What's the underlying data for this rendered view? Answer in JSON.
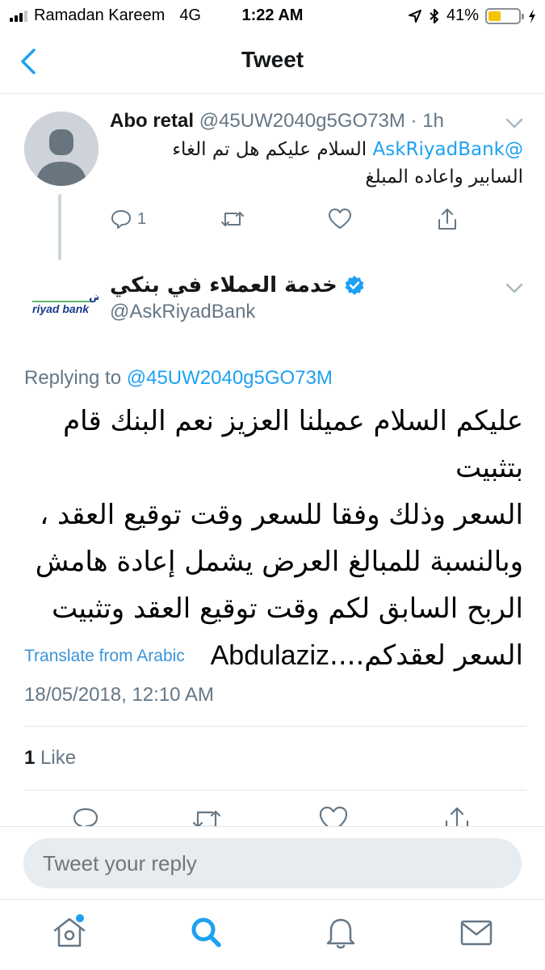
{
  "status_bar": {
    "carrier": "Ramadan Kareem",
    "network": "4G",
    "time": "1:22 AM",
    "battery_percent": "41%",
    "battery_level": 0.41
  },
  "nav": {
    "title": "Tweet",
    "back_icon": "chevron-left-icon"
  },
  "parent_tweet": {
    "author_name": "Abo retal",
    "author_handle": "@45UW2040g5GO73M",
    "separator": "·",
    "age": "1h",
    "mention": "@AskRiyadBank",
    "text_line1": "السلام عليكم هل تم الغاء",
    "text_line2": "السابير واعاده المبلغ",
    "reply_count": "1"
  },
  "main_tweet": {
    "author_name": "خدمة العملاء في بنكي",
    "verified": true,
    "author_handle": "@AskRiyadBank",
    "logo_text_ar": "بنك الرياض",
    "logo_text_en": "riyad bank",
    "replying_to_label": "Replying to",
    "replying_to_handle": "@45UW2040g5GO73M",
    "text_line1": "عليكم السلام عميلنا العزيز نعم البنك قام بتثبيت",
    "text_line2": "السعر وذلك وفقا للسعر وقت توقيع العقد ،",
    "text_line3": "وبالنسبة للمبالغ العرض يشمل إعادة هامش",
    "text_line4": "الربح السابق لكم وقت توقيع العقد وتثبيت",
    "text_line5_ar": "السعر لعقدكم....",
    "text_line5_en": "Abdulaziz",
    "translate_label": "Translate from Arabic",
    "timestamp": "18/05/2018, 12:10 AM",
    "like_count": "1",
    "like_label": "Like"
  },
  "reply_bar": {
    "placeholder": "Tweet your reply"
  },
  "tab_bar": {
    "tabs": [
      "home-icon",
      "search-icon",
      "notifications-icon",
      "messages-icon"
    ],
    "active": "search-icon"
  },
  "colors": {
    "accent": "#1da1f2",
    "muted": "#657786",
    "divider": "#e1e8ed",
    "input_bg": "#e6ecf0",
    "battery": "#f5c400"
  }
}
